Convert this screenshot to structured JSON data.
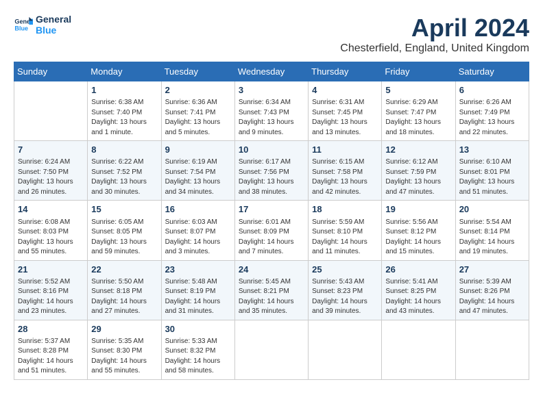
{
  "header": {
    "logo_line1": "General",
    "logo_line2": "Blue",
    "month_title": "April 2024",
    "location": "Chesterfield, England, United Kingdom"
  },
  "days_of_week": [
    "Sunday",
    "Monday",
    "Tuesday",
    "Wednesday",
    "Thursday",
    "Friday",
    "Saturday"
  ],
  "weeks": [
    [
      {
        "day": "",
        "sunrise": "",
        "sunset": "",
        "daylight": ""
      },
      {
        "day": "1",
        "sunrise": "Sunrise: 6:38 AM",
        "sunset": "Sunset: 7:40 PM",
        "daylight": "Daylight: 13 hours and 1 minute."
      },
      {
        "day": "2",
        "sunrise": "Sunrise: 6:36 AM",
        "sunset": "Sunset: 7:41 PM",
        "daylight": "Daylight: 13 hours and 5 minutes."
      },
      {
        "day": "3",
        "sunrise": "Sunrise: 6:34 AM",
        "sunset": "Sunset: 7:43 PM",
        "daylight": "Daylight: 13 hours and 9 minutes."
      },
      {
        "day": "4",
        "sunrise": "Sunrise: 6:31 AM",
        "sunset": "Sunset: 7:45 PM",
        "daylight": "Daylight: 13 hours and 13 minutes."
      },
      {
        "day": "5",
        "sunrise": "Sunrise: 6:29 AM",
        "sunset": "Sunset: 7:47 PM",
        "daylight": "Daylight: 13 hours and 18 minutes."
      },
      {
        "day": "6",
        "sunrise": "Sunrise: 6:26 AM",
        "sunset": "Sunset: 7:49 PM",
        "daylight": "Daylight: 13 hours and 22 minutes."
      }
    ],
    [
      {
        "day": "7",
        "sunrise": "Sunrise: 6:24 AM",
        "sunset": "Sunset: 7:50 PM",
        "daylight": "Daylight: 13 hours and 26 minutes."
      },
      {
        "day": "8",
        "sunrise": "Sunrise: 6:22 AM",
        "sunset": "Sunset: 7:52 PM",
        "daylight": "Daylight: 13 hours and 30 minutes."
      },
      {
        "day": "9",
        "sunrise": "Sunrise: 6:19 AM",
        "sunset": "Sunset: 7:54 PM",
        "daylight": "Daylight: 13 hours and 34 minutes."
      },
      {
        "day": "10",
        "sunrise": "Sunrise: 6:17 AM",
        "sunset": "Sunset: 7:56 PM",
        "daylight": "Daylight: 13 hours and 38 minutes."
      },
      {
        "day": "11",
        "sunrise": "Sunrise: 6:15 AM",
        "sunset": "Sunset: 7:58 PM",
        "daylight": "Daylight: 13 hours and 42 minutes."
      },
      {
        "day": "12",
        "sunrise": "Sunrise: 6:12 AM",
        "sunset": "Sunset: 7:59 PM",
        "daylight": "Daylight: 13 hours and 47 minutes."
      },
      {
        "day": "13",
        "sunrise": "Sunrise: 6:10 AM",
        "sunset": "Sunset: 8:01 PM",
        "daylight": "Daylight: 13 hours and 51 minutes."
      }
    ],
    [
      {
        "day": "14",
        "sunrise": "Sunrise: 6:08 AM",
        "sunset": "Sunset: 8:03 PM",
        "daylight": "Daylight: 13 hours and 55 minutes."
      },
      {
        "day": "15",
        "sunrise": "Sunrise: 6:05 AM",
        "sunset": "Sunset: 8:05 PM",
        "daylight": "Daylight: 13 hours and 59 minutes."
      },
      {
        "day": "16",
        "sunrise": "Sunrise: 6:03 AM",
        "sunset": "Sunset: 8:07 PM",
        "daylight": "Daylight: 14 hours and 3 minutes."
      },
      {
        "day": "17",
        "sunrise": "Sunrise: 6:01 AM",
        "sunset": "Sunset: 8:09 PM",
        "daylight": "Daylight: 14 hours and 7 minutes."
      },
      {
        "day": "18",
        "sunrise": "Sunrise: 5:59 AM",
        "sunset": "Sunset: 8:10 PM",
        "daylight": "Daylight: 14 hours and 11 minutes."
      },
      {
        "day": "19",
        "sunrise": "Sunrise: 5:56 AM",
        "sunset": "Sunset: 8:12 PM",
        "daylight": "Daylight: 14 hours and 15 minutes."
      },
      {
        "day": "20",
        "sunrise": "Sunrise: 5:54 AM",
        "sunset": "Sunset: 8:14 PM",
        "daylight": "Daylight: 14 hours and 19 minutes."
      }
    ],
    [
      {
        "day": "21",
        "sunrise": "Sunrise: 5:52 AM",
        "sunset": "Sunset: 8:16 PM",
        "daylight": "Daylight: 14 hours and 23 minutes."
      },
      {
        "day": "22",
        "sunrise": "Sunrise: 5:50 AM",
        "sunset": "Sunset: 8:18 PM",
        "daylight": "Daylight: 14 hours and 27 minutes."
      },
      {
        "day": "23",
        "sunrise": "Sunrise: 5:48 AM",
        "sunset": "Sunset: 8:19 PM",
        "daylight": "Daylight: 14 hours and 31 minutes."
      },
      {
        "day": "24",
        "sunrise": "Sunrise: 5:45 AM",
        "sunset": "Sunset: 8:21 PM",
        "daylight": "Daylight: 14 hours and 35 minutes."
      },
      {
        "day": "25",
        "sunrise": "Sunrise: 5:43 AM",
        "sunset": "Sunset: 8:23 PM",
        "daylight": "Daylight: 14 hours and 39 minutes."
      },
      {
        "day": "26",
        "sunrise": "Sunrise: 5:41 AM",
        "sunset": "Sunset: 8:25 PM",
        "daylight": "Daylight: 14 hours and 43 minutes."
      },
      {
        "day": "27",
        "sunrise": "Sunrise: 5:39 AM",
        "sunset": "Sunset: 8:26 PM",
        "daylight": "Daylight: 14 hours and 47 minutes."
      }
    ],
    [
      {
        "day": "28",
        "sunrise": "Sunrise: 5:37 AM",
        "sunset": "Sunset: 8:28 PM",
        "daylight": "Daylight: 14 hours and 51 minutes."
      },
      {
        "day": "29",
        "sunrise": "Sunrise: 5:35 AM",
        "sunset": "Sunset: 8:30 PM",
        "daylight": "Daylight: 14 hours and 55 minutes."
      },
      {
        "day": "30",
        "sunrise": "Sunrise: 5:33 AM",
        "sunset": "Sunset: 8:32 PM",
        "daylight": "Daylight: 14 hours and 58 minutes."
      },
      {
        "day": "",
        "sunrise": "",
        "sunset": "",
        "daylight": ""
      },
      {
        "day": "",
        "sunrise": "",
        "sunset": "",
        "daylight": ""
      },
      {
        "day": "",
        "sunrise": "",
        "sunset": "",
        "daylight": ""
      },
      {
        "day": "",
        "sunrise": "",
        "sunset": "",
        "daylight": ""
      }
    ]
  ]
}
